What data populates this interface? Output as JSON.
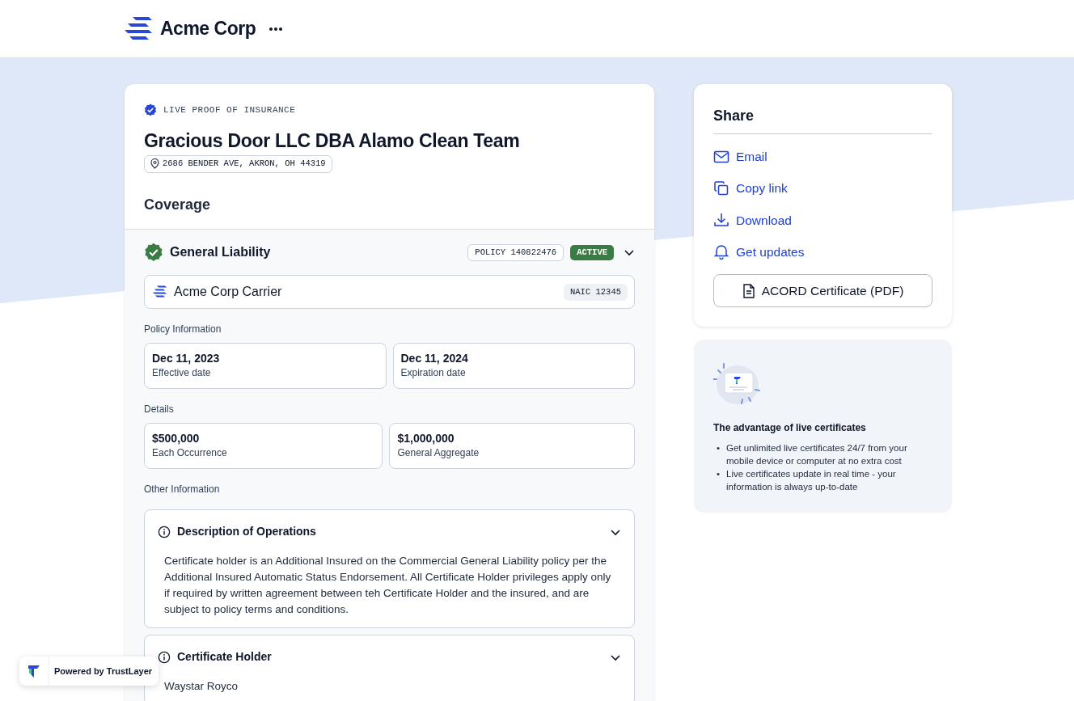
{
  "header": {
    "brand": "Acme Corp"
  },
  "proof": {
    "eyebrow": "LIVE PROOF OF INSURANCE",
    "name": "Gracious Door LLC DBA Alamo Clean Team",
    "address": "2686 BENDER AVE, AKRON, OH 44319",
    "section_title": "Coverage"
  },
  "coverage": {
    "title": "General Liability",
    "policy": "POLICY 140822476",
    "status": "ACTIVE",
    "expanded": true,
    "carrier": {
      "name": "Acme Corp Carrier",
      "naic": "NAIC 12345"
    },
    "groups": [
      {
        "label": "Policy Information",
        "items": [
          {
            "value": "Dec 11, 2023",
            "label": "Effective date"
          },
          {
            "value": "Dec 11, 2024",
            "label": "Expiration date"
          }
        ]
      },
      {
        "label": "Details",
        "items": [
          {
            "value": "$500,000",
            "label": "Each Occurrence"
          },
          {
            "value": "$1,000,000",
            "label": "General Aggregate"
          }
        ]
      }
    ],
    "other_label": "Other Information",
    "accordions": [
      {
        "title": "Description of Operations",
        "expanded": true,
        "body": "Certificate holder is an Additional Insured on the Commercial General Liability policy per the Additional Insured Automatic Status Endorsement. All Certificate Holder privileges apply only if required by written agreement between teh Certificate Holder and the insured, and are subject to policy terms and conditions."
      },
      {
        "title": "Certificate Holder",
        "expanded": true,
        "body": "Waystar Royco"
      }
    ]
  },
  "share": {
    "title": "Share",
    "links": [
      {
        "kind": "email",
        "label": "Email"
      },
      {
        "kind": "copy",
        "label": "Copy link"
      },
      {
        "kind": "download",
        "label": "Download"
      },
      {
        "kind": "bell",
        "label": "Get updates"
      }
    ],
    "button": "ACORD Certificate (PDF)"
  },
  "advantage": {
    "title": "The advantage of live certificates",
    "bullets": [
      {
        "marker": "•",
        "text": "Get unlimited live certificates 24/7 from your mobile device or computer at no extra cost"
      },
      {
        "marker": "•",
        "text": "Live certificates update in real time - your information is always up-to-date"
      }
    ]
  },
  "powered": "Powered by TrustLayer"
}
